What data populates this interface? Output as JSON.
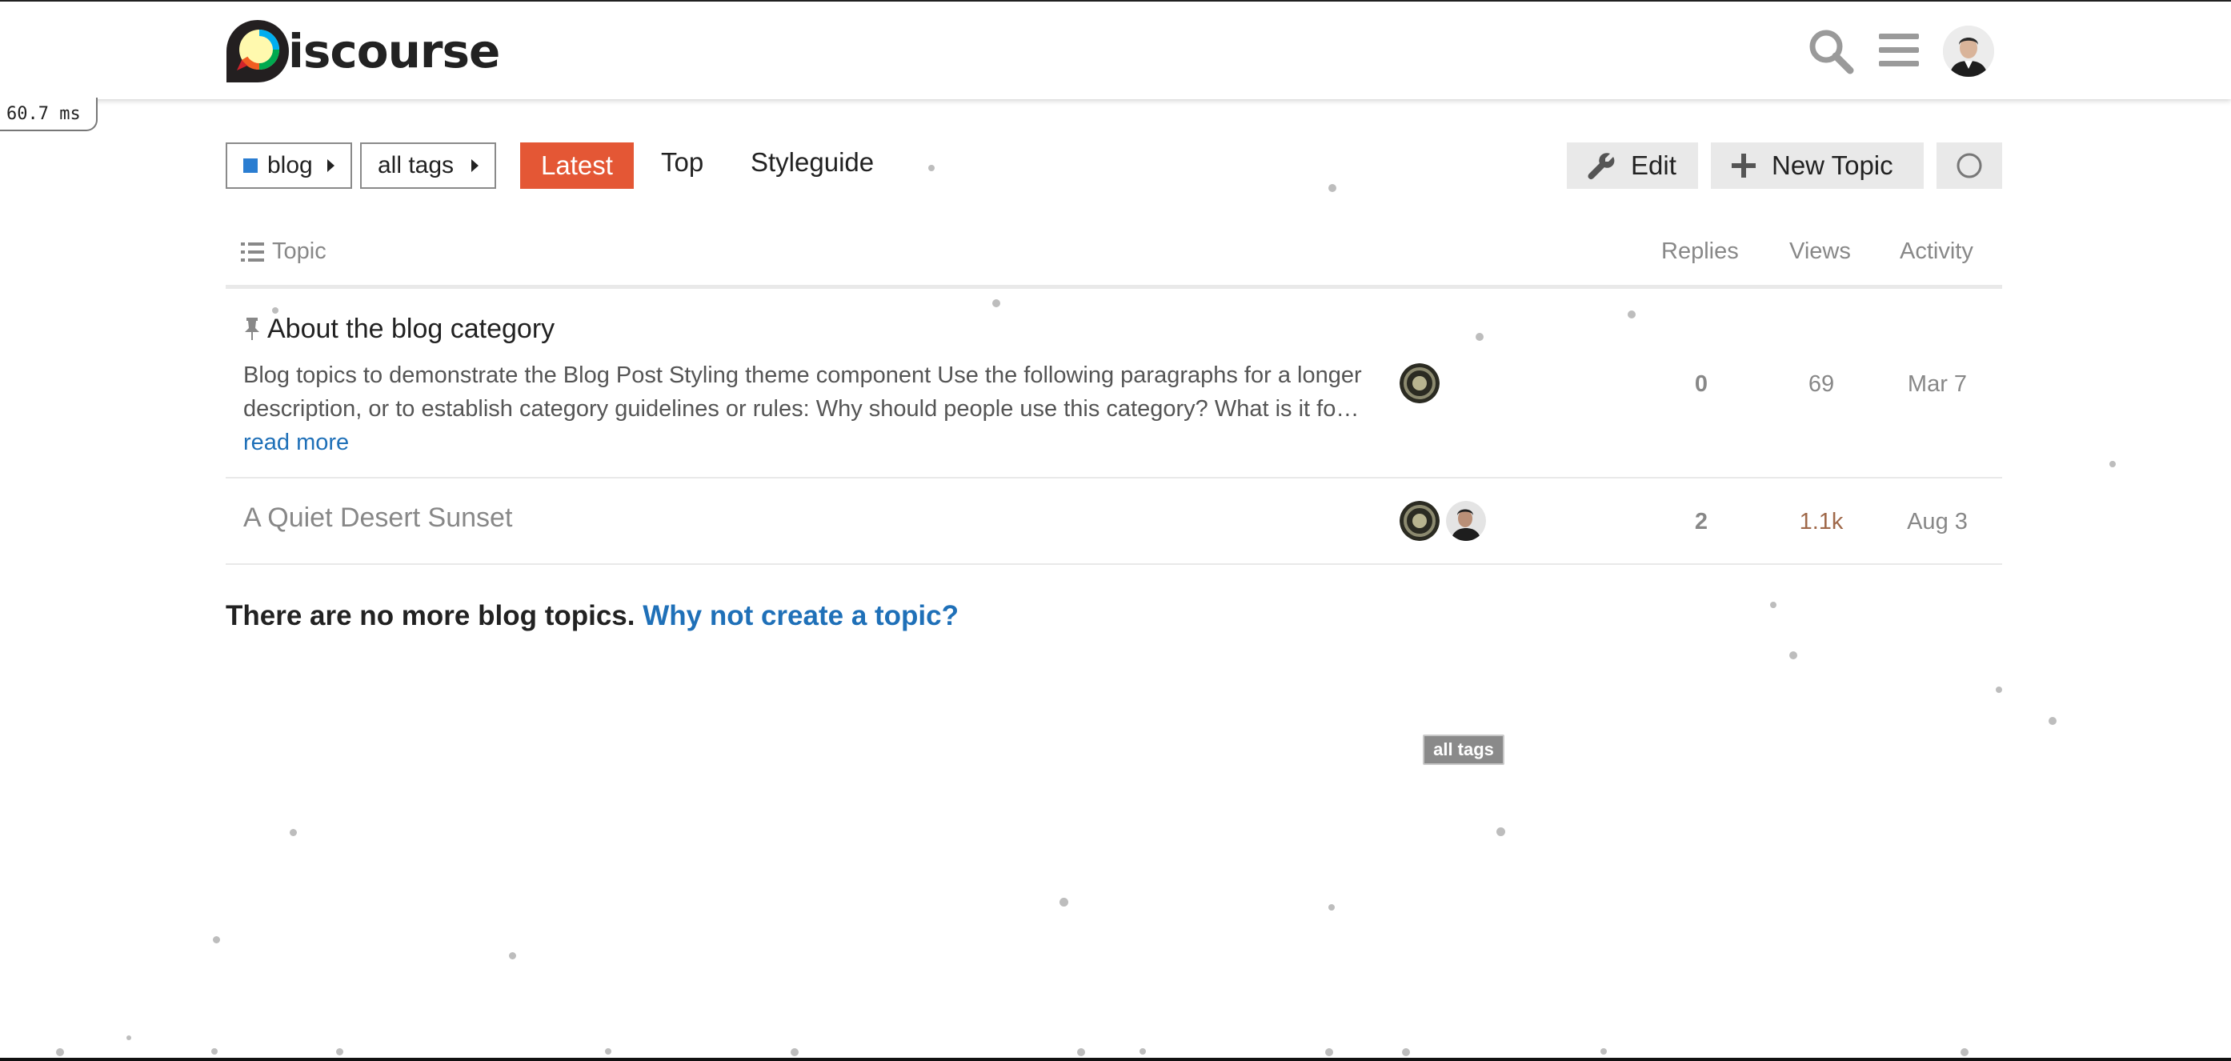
{
  "header": {
    "logo_text": "iscourse",
    "logo_alt": "Discourse",
    "search_icon": "search-icon",
    "menu_icon": "hamburger-menu-icon",
    "avatar_icon": "user-avatar"
  },
  "perf": {
    "label": "60.7 ms"
  },
  "navigation": {
    "category_crumb": "blog",
    "category_color": "#2a7dd1",
    "tags_crumb": "all tags",
    "tabs": [
      {
        "label": "Latest",
        "active": true
      },
      {
        "label": "Top",
        "active": false
      },
      {
        "label": "Styleguide",
        "active": false
      }
    ],
    "edit_label": "Edit",
    "new_topic_label": "New Topic",
    "accent_color": "#e45735"
  },
  "topic_list": {
    "columns": {
      "topic": "Topic",
      "replies": "Replies",
      "views": "Views",
      "activity": "Activity"
    },
    "topics": [
      {
        "title": "About the blog category",
        "pinned": true,
        "excerpt": "Blog topics to demonstrate the Blog Post Styling theme component Use the following paragraphs for a longer description, or to establish category guidelines or rules: Why should people use this category? What is it fo…",
        "read_more": "read more",
        "replies": "0",
        "views": "69",
        "activity": "Mar 7"
      },
      {
        "title": "A Quiet Desert Sunset",
        "pinned": false,
        "replies": "2",
        "views": "1.1k",
        "activity": "Aug 3"
      }
    ]
  },
  "footer": {
    "message": "There are no more blog topics.",
    "link": "Why not create a topic?"
  },
  "tooltip": {
    "text": "all tags"
  },
  "colors": {
    "link": "#1f70b8",
    "button_grey": "#e9e9e9",
    "views_hot": "#a0694a"
  }
}
